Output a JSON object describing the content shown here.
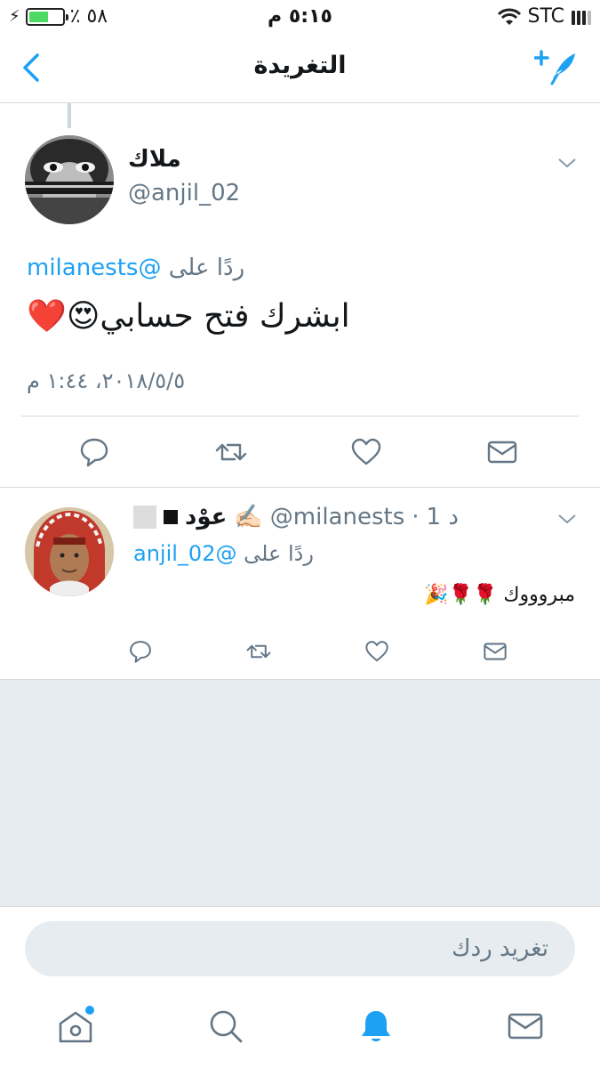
{
  "status_bar": {
    "battery_text": "٪ ٥٨",
    "battery_level": 0.58,
    "time": "٥:١٥ م",
    "carrier": "STC"
  },
  "nav": {
    "title": "التغريدة",
    "back_icon": "chevron-left-icon",
    "compose_icon": "compose-tweet-icon"
  },
  "main_tweet": {
    "name": "ملاك",
    "handle": "@anjil_02",
    "reply_to_prefix": "ردًا على",
    "reply_to_handle": "@milanests",
    "text": "ابشرك فتح حسابي😍❤️",
    "date": "٢٠١٨/٥/٥، ١:٤٤ م"
  },
  "reply_tweet": {
    "name": "عوْد",
    "name_emoji": "✍🏻",
    "handle": "@milanests",
    "time_ago": "1 د",
    "reply_to_prefix": "ردًا على",
    "reply_to_handle": "@anjil_02",
    "text": "مبروووك 🌹🌹🎉"
  },
  "composer": {
    "placeholder": "تغريد ردك"
  },
  "colors": {
    "accent": "#1da1f2",
    "muted": "#657786",
    "divider": "#d9d9d9",
    "background_grey": "#e6ecf0"
  }
}
